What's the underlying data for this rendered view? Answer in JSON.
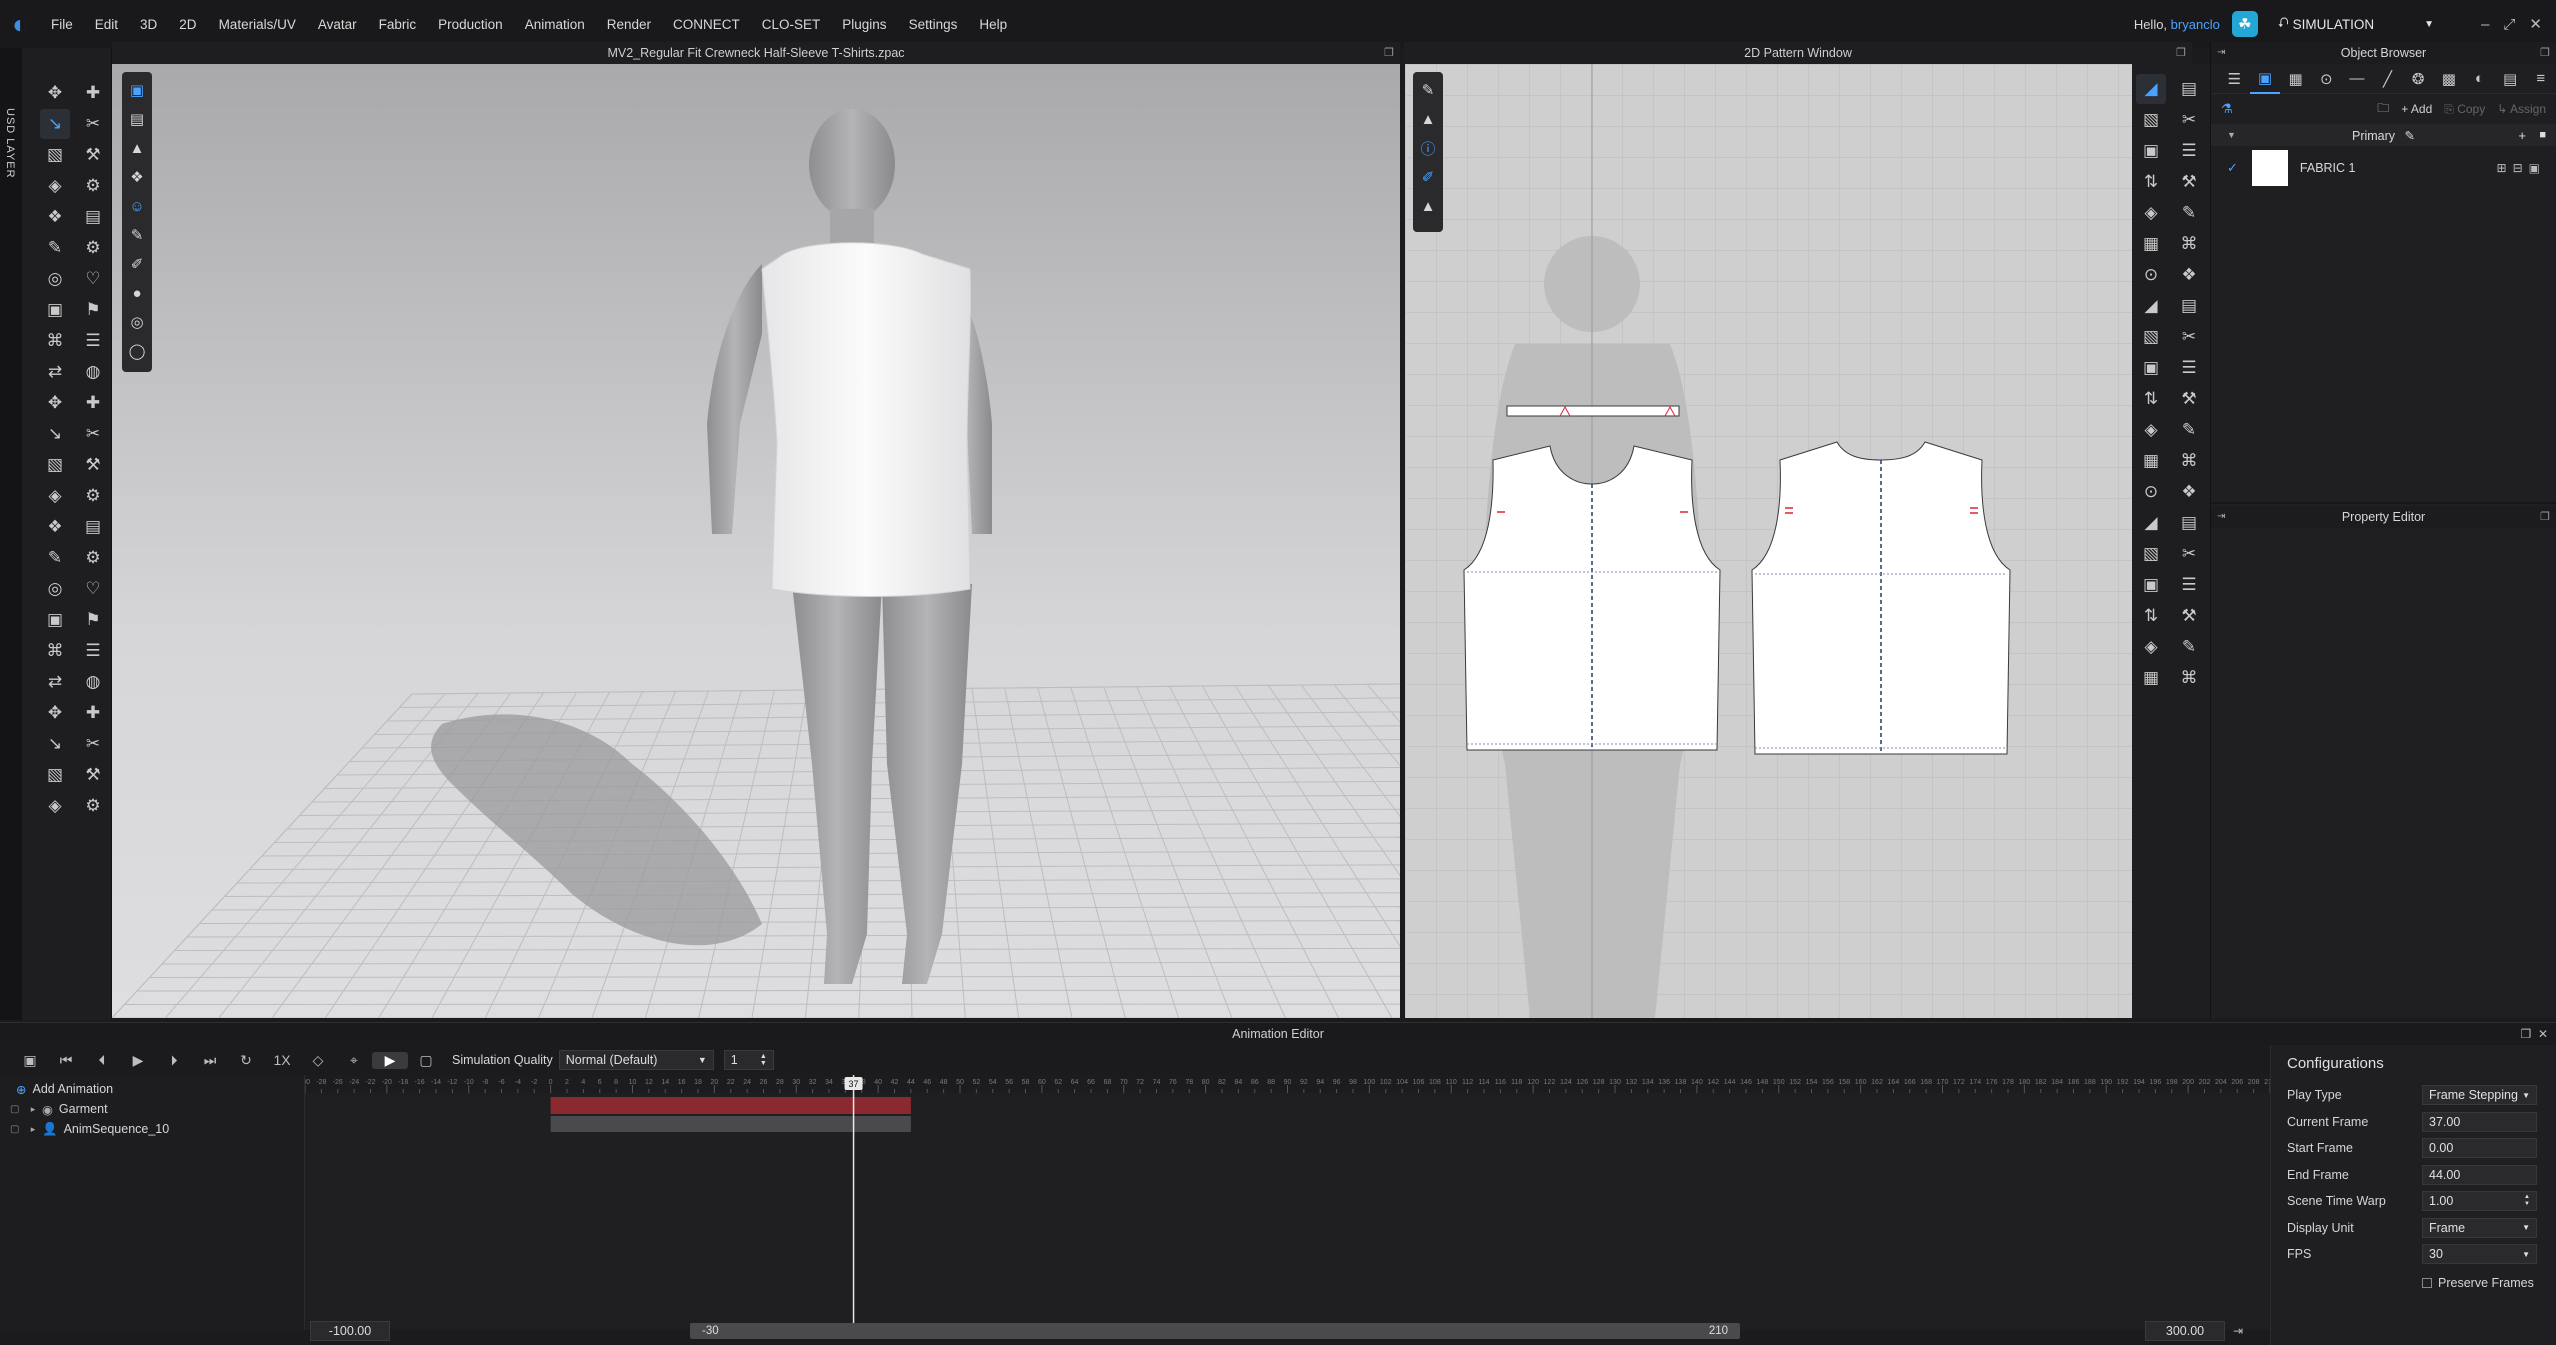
{
  "menu": [
    "File",
    "Edit",
    "3D",
    "2D",
    "Materials/UV",
    "Avatar",
    "Fabric",
    "Production",
    "Animation",
    "Render",
    "CONNECT",
    "CLO-SET",
    "Plugins",
    "Settings",
    "Help"
  ],
  "user": {
    "greeting": "Hello, ",
    "name": "bryanclo"
  },
  "mode": "SIMULATION",
  "usd_label": "USD LAYER",
  "window3d": {
    "title": "MV2_Regular Fit Crewneck Half-Sleeve T-Shirts.zpac"
  },
  "window2d": {
    "title": "2D Pattern Window"
  },
  "object_browser": {
    "title": "Object Browser",
    "actions": {
      "add": "+ Add",
      "copy": "Copy",
      "assign": "Assign"
    },
    "group": "Primary",
    "fabrics": [
      {
        "name": "FABRIC 1",
        "checked": true
      }
    ]
  },
  "property_editor": {
    "title": "Property Editor"
  },
  "animation": {
    "title": "Animation Editor",
    "speed": "1X",
    "simulation_quality_label": "Simulation Quality",
    "simulation_quality_value": "Normal (Default)",
    "step_value": "1",
    "add_animation": "Add Animation",
    "tracks": [
      "Garment",
      "AnimSequence_10"
    ],
    "current_frame_marker": "37",
    "range_start": "-100.00",
    "range_end": "300.00",
    "scroll_start": "-30",
    "scroll_end": "210",
    "timeline": {
      "min": -30,
      "max": 210,
      "clip_start": 0,
      "clip_end": 44,
      "current": 37
    }
  },
  "config": {
    "title": "Configurations",
    "rows": [
      {
        "label": "Play Type",
        "value": "Frame Stepping",
        "dropdown": true
      },
      {
        "label": "Current Frame",
        "value": "37.00"
      },
      {
        "label": "Start Frame",
        "value": "0.00"
      },
      {
        "label": "End Frame",
        "value": "44.00"
      },
      {
        "label": "Scene Time Warp",
        "value": "1.00",
        "spinner": true
      },
      {
        "label": "Display Unit",
        "value": "Frame",
        "dropdown": true
      },
      {
        "label": "FPS",
        "value": "30",
        "dropdown": true
      }
    ],
    "preserve_frames": "Preserve Frames"
  },
  "colors": {
    "accent": "#4aa3ff",
    "clip": "#8a2a30"
  }
}
